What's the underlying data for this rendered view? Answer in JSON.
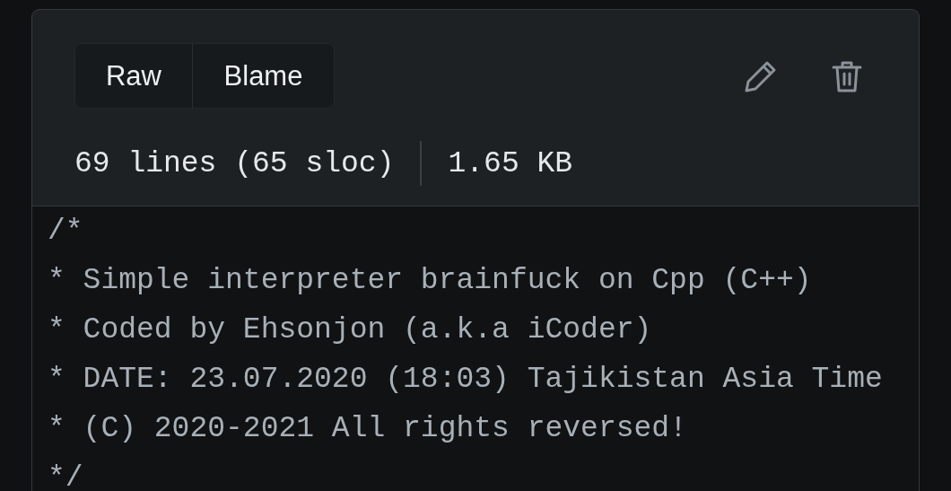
{
  "file_header": {
    "view_buttons": [
      "Raw",
      "Blame"
    ],
    "actions": [
      {
        "kind": "edit"
      },
      {
        "kind": "delete"
      }
    ],
    "line_count": "69 lines (65 sloc)",
    "file_size": "1.65 KB"
  },
  "code_lines": [
    "/*",
    "* Simple interpreter brainfuck on Cpp (C++)",
    "* Coded by Ehsonjon (a.k.a iCoder)",
    "* DATE: 23.07.2020 (18:03) Tajikistan Asia Time",
    "* (C) 2020-2021 All rights reversed!",
    "*/"
  ]
}
